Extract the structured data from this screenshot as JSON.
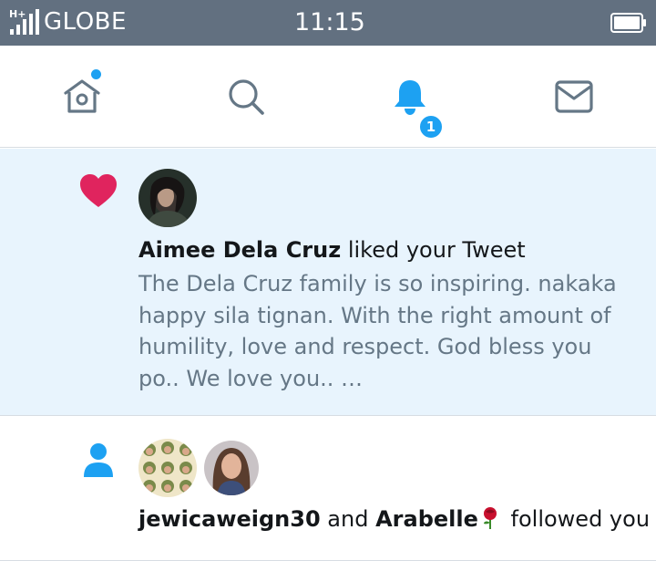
{
  "status_bar": {
    "network": "H+",
    "carrier": "GLOBE",
    "time": "11:15"
  },
  "tabs": [
    {
      "name": "home",
      "icon": "home-icon",
      "active": false,
      "has_dot": true
    },
    {
      "name": "search",
      "icon": "search-icon",
      "active": false
    },
    {
      "name": "notifications",
      "icon": "bell-icon",
      "active": true,
      "badge": "1"
    },
    {
      "name": "messages",
      "icon": "mail-icon",
      "active": false
    }
  ],
  "notifications": [
    {
      "type": "like",
      "icon": "heart-icon",
      "actor": "Aimee Dela Cruz",
      "action": " liked your Tweet",
      "tweet_text": "The Dela Cruz family is so inspiring. nakaka happy sila tignan. With the right amount of humility, love and respect. God bless you po.. We love you.. …"
    },
    {
      "type": "follow",
      "icon": "person-icon",
      "actor1": "jewicaweign30",
      "connector": " and ",
      "actor2": "Arabelle",
      "actor2_emoji": "rose-emoji",
      "action": " followed you"
    }
  ],
  "colors": {
    "accent": "#1da1f2",
    "like": "#e0245e",
    "status_bar": "#627080",
    "highlight_bg": "#e8f4fd",
    "secondary_text": "#657786",
    "icon_gray": "#657786"
  }
}
